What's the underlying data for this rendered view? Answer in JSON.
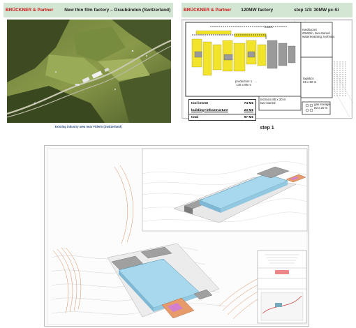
{
  "slide_left": {
    "brand": "BRÜCKNER & Partner",
    "title": "New thin film factory – Graubünden (Switzerland)",
    "caption": "Existing industry area near Fideris (Switzerland)"
  },
  "slide_right": {
    "brand": "BRÜCKNER & Partner",
    "title": "120MW factory",
    "subtitle": "step 1/3: 30MW µc-Si",
    "step_label": "step 1",
    "labels": {
      "production": "production 1",
      "production_size": "145 x 85 m",
      "technics": "technics 80 x 20 m",
      "technics_2": "two-storied",
      "media": "media port",
      "media_2": "20x50m, two-storied",
      "media_3": "watertreatning, technics",
      "logistics": "logistics",
      "logistics_size": "65 x 50 m",
      "gas": "gas storage",
      "gas_size": "50 x 20 m",
      "boxes": "boxes"
    },
    "costs": [
      {
        "label": "tool invest",
        "value": "74 M€"
      },
      {
        "label": "building+infrastructure",
        "value": "23 M€"
      },
      {
        "label": "total",
        "value": "97 M€"
      }
    ]
  },
  "colors": {
    "brand_red": "#cc1111",
    "header_bg": "#d3e5d3",
    "hall_blue": "#a8d8ee",
    "annex_grey": "#a0a0a0",
    "annex_orange": "#e79a6a",
    "annex_magenta": "#d37fd0",
    "contour_orange": "#d98b5a"
  }
}
